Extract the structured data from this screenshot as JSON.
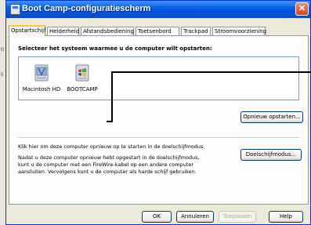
{
  "desktop": {
    "left_ticks": [
      "ti",
      "li"
    ]
  },
  "window": {
    "title": "Boot Camp-configuratiescherm",
    "close_glyph": "✕"
  },
  "tabs": [
    {
      "label": "Opstartschijf",
      "active": true
    },
    {
      "label": "Helderheid"
    },
    {
      "label": "Afstandsbediening"
    },
    {
      "label": "Toetsenbord"
    },
    {
      "label": "Trackpad"
    },
    {
      "label": "Stroomvoorziening"
    }
  ],
  "startup": {
    "heading": "Selecteer het systeem waarmee u de computer wilt opstarten:",
    "disks": [
      {
        "label": "Macintosh HD",
        "icon": "mac-disk-icon"
      },
      {
        "label": "BOOTCAMP",
        "icon": "windows-disk-icon"
      }
    ],
    "restart_button": "Opnieuw opstarten..."
  },
  "target_mode": {
    "line1": "Klik hier om deze computer opnieuw op te starten in de doelschijfmodus.",
    "paragraph": [
      "Nadat u deze computer opnieuw hebt opgestart in de doelschijfmodus,",
      "kunt u de computer met een FireWire-kabel op een andere computer",
      "aansluiten. Vervolgens kunt u de computer als harde schijf gebruiken."
    ],
    "button": "Doelschijfmodus..."
  },
  "footer": {
    "ok": "OK",
    "cancel": "Annuleren",
    "apply": "Toepassen",
    "help": "Help"
  },
  "colors": {
    "title_bar": "#0a5fe6",
    "close": "#d0461f",
    "tab_highlight": "#ffc83c"
  }
}
